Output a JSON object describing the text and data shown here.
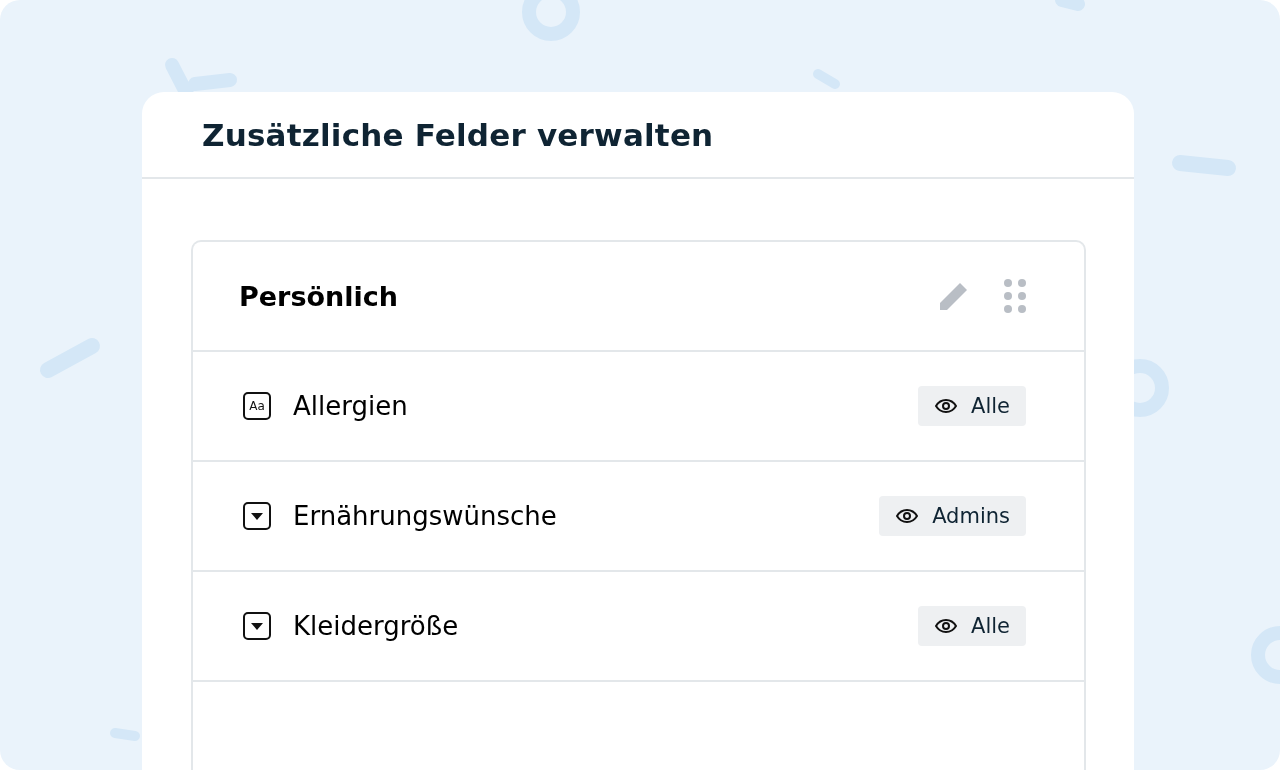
{
  "dialog": {
    "title": "Zusätzliche Felder verwalten"
  },
  "section": {
    "title": "Persönlich",
    "fields": [
      {
        "kind": "text",
        "type_label": "Aa",
        "name": "Allergien",
        "visibility": "Alle"
      },
      {
        "kind": "select",
        "name": "Ernährungswünsche",
        "visibility": "Admins"
      },
      {
        "kind": "select",
        "name": "Kleidergröße",
        "visibility": "Alle"
      },
      {
        "kind": "empty"
      }
    ]
  }
}
